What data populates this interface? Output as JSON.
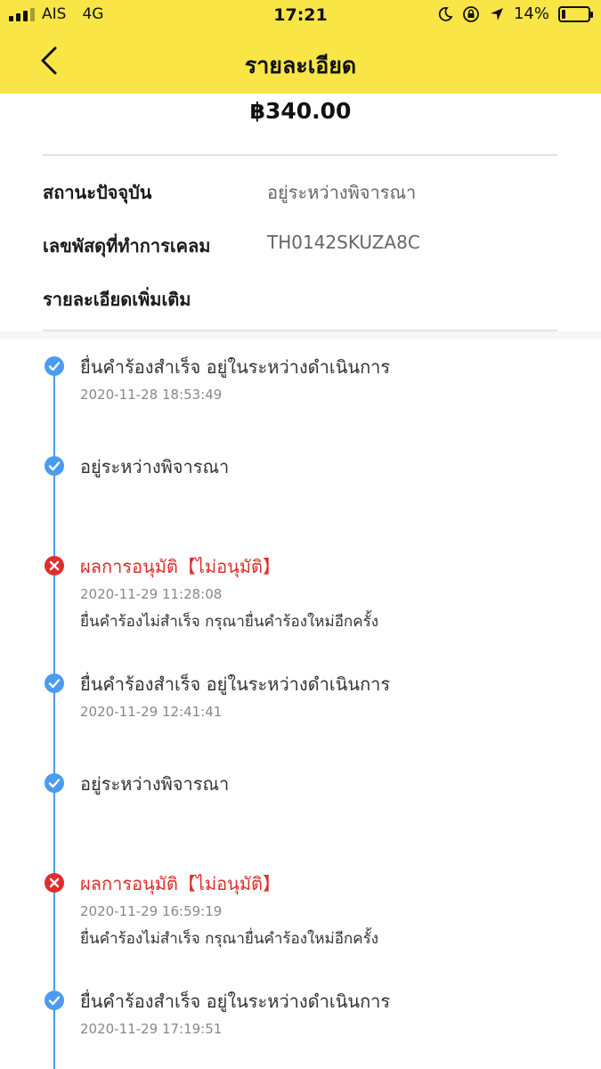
{
  "colors": {
    "brand": "#F9E545",
    "timeline": "#4a9cf0",
    "reject": "#e02d2d"
  },
  "status_bar": {
    "carrier": "AIS",
    "network": "4G",
    "time": "17:21",
    "battery": "14%",
    "battery_level": 0.14,
    "icons": [
      "signal-icon",
      "moon-icon",
      "orientation-lock-icon",
      "location-icon",
      "battery-icon"
    ]
  },
  "header": {
    "title": "รายละเอียด",
    "back_icon": "chevron-left-icon"
  },
  "amount": "฿340.00",
  "info": {
    "status_label": "สถานะปัจจุบัน",
    "status_value": "อยู่ระหว่างพิจารณา",
    "tracking_label": "เลขพัสดุที่ทำการเคลม",
    "tracking_value": "TH0142SKUZA8C",
    "more_label": "รายละเอียดเพิ่มเติม"
  },
  "timeline": [
    {
      "type": "success",
      "title": "ยื่นคำร้องสำเร็จ อยู่ในระหว่างดำเนินการ",
      "time": "2020-11-28 18:53:49",
      "note": ""
    },
    {
      "type": "success",
      "title": "อยู่ระหว่างพิจารณา",
      "time": "",
      "note": ""
    },
    {
      "type": "reject",
      "title": "ผลการอนุมัติ【ไม่อนุมัติ】",
      "time": "2020-11-29 11:28:08",
      "note": "ยื่นคำร้องไม่สำเร็จ กรุณายื่นคำร้องใหม่อีกครั้ง"
    },
    {
      "type": "success",
      "title": "ยื่นคำร้องสำเร็จ อยู่ในระหว่างดำเนินการ",
      "time": "2020-11-29 12:41:41",
      "note": ""
    },
    {
      "type": "success",
      "title": "อยู่ระหว่างพิจารณา",
      "time": "",
      "note": ""
    },
    {
      "type": "reject",
      "title": "ผลการอนุมัติ【ไม่อนุมัติ】",
      "time": "2020-11-29 16:59:19",
      "note": "ยื่นคำร้องไม่สำเร็จ กรุณายื่นคำร้องใหม่อีกครั้ง"
    },
    {
      "type": "success",
      "title": "ยื่นคำร้องสำเร็จ อยู่ในระหว่างดำเนินการ",
      "time": "2020-11-29 17:19:51",
      "note": ""
    }
  ]
}
